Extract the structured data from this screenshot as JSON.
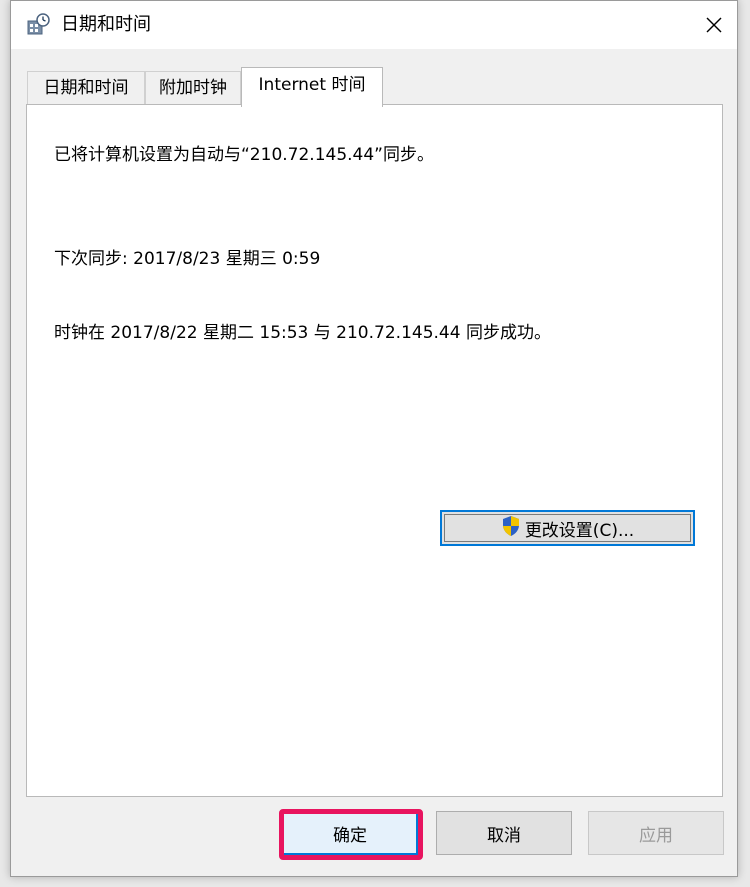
{
  "window": {
    "title": "日期和时间",
    "icons": {
      "app": "date-time-icon",
      "close": "close-icon"
    }
  },
  "tabs": [
    {
      "label": "日期和时间",
      "active": false
    },
    {
      "label": "附加时钟",
      "active": false
    },
    {
      "label": "Internet 时间",
      "active": true
    }
  ],
  "panel": {
    "sync_config_text": "已将计算机设置为自动与“210.72.145.44”同步。",
    "next_sync_text": "下次同步: 2017/8/23 星期三 0:59",
    "last_sync_text": "时钟在 2017/8/22 星期二 15:53 与 210.72.145.44 同步成功。",
    "change_settings": {
      "label": "更改设置(C)...",
      "icon": "uac-shield-icon"
    }
  },
  "buttons": {
    "ok_label": "确定",
    "cancel_label": "取消",
    "apply_label": "应用"
  },
  "colors": {
    "accent": "#0078d7",
    "highlight": "#e8145f"
  }
}
